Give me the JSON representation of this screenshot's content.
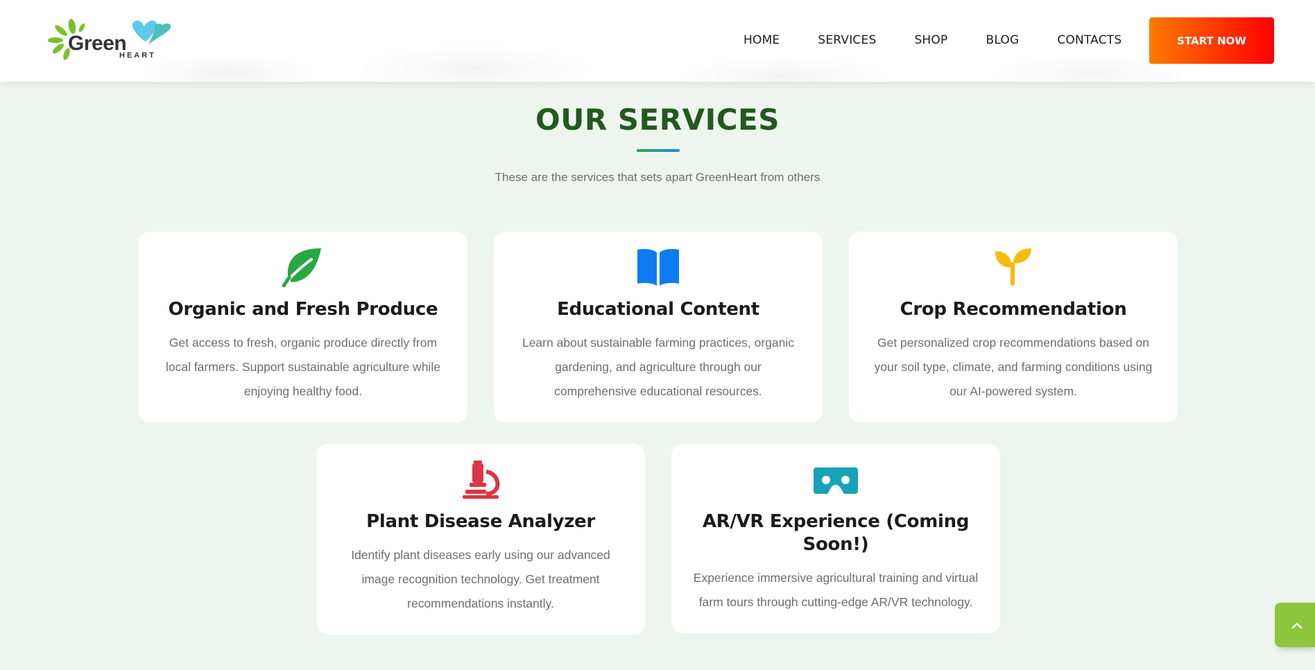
{
  "header": {
    "logo": {
      "word": "Green",
      "sub": "HEART"
    },
    "nav": [
      {
        "label": "HOME"
      },
      {
        "label": "SERVICES"
      },
      {
        "label": "SHOP"
      },
      {
        "label": "BLOG"
      },
      {
        "label": "CONTACTS"
      }
    ],
    "cta_label": "START NOW"
  },
  "section": {
    "title": "OUR SERVICES",
    "subtitle": "These are the services that sets apart GreenHeart from others"
  },
  "services": [
    {
      "title": "Organic and Fresh Produce",
      "description": "Get access to fresh, organic produce directly from local farmers. Support sustainable agriculture while enjoying healthy food.",
      "icon": "leaf-icon",
      "color": "#28a745"
    },
    {
      "title": "Educational Content",
      "description": "Learn about sustainable farming practices, organic gardening, and agriculture through our comprehensive educational resources.",
      "icon": "book-icon",
      "color": "#0d7cf2"
    },
    {
      "title": "Crop Recommendation",
      "description": "Get personalized crop recommendations based on your soil type, climate, and farming conditions using our AI-powered system.",
      "icon": "seedling-icon",
      "color": "#f5bd0a"
    },
    {
      "title": "Plant Disease Analyzer",
      "description": "Identify plant diseases early using our advanced image recognition technology. Get treatment recommendations instantly.",
      "icon": "microscope-icon",
      "color": "#dc3545"
    },
    {
      "title": "AR/VR Experience (Coming Soon!)",
      "description": "Experience immersive agricultural training and virtual farm tours through cutting-edge AR/VR technology.",
      "icon": "vr-headset-icon",
      "color": "#17a2b8"
    }
  ],
  "back_to_top": {
    "icon": "chevron-up-icon",
    "color": "#8cc63f"
  }
}
